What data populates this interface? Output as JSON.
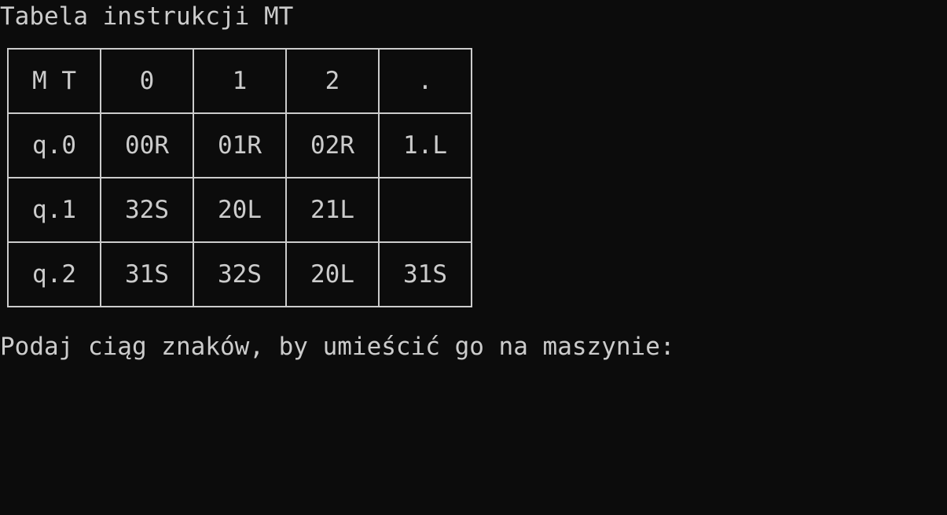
{
  "console": {
    "title": "Tabela instrukcji MT",
    "prompt": "Podaj ciąg znaków, by umieścić go na maszynie:"
  },
  "table": {
    "header": [
      "M T",
      "0",
      "1",
      "2",
      "."
    ],
    "rows": [
      [
        "q.0",
        "00R",
        "01R",
        "02R",
        "1.L"
      ],
      [
        "q.1",
        "32S",
        "20L",
        "21L",
        ""
      ],
      [
        "q.2",
        "31S",
        "32S",
        "20L",
        "31S"
      ]
    ]
  },
  "colors": {
    "background": "#0c0c0c",
    "foreground": "#cccccc"
  }
}
